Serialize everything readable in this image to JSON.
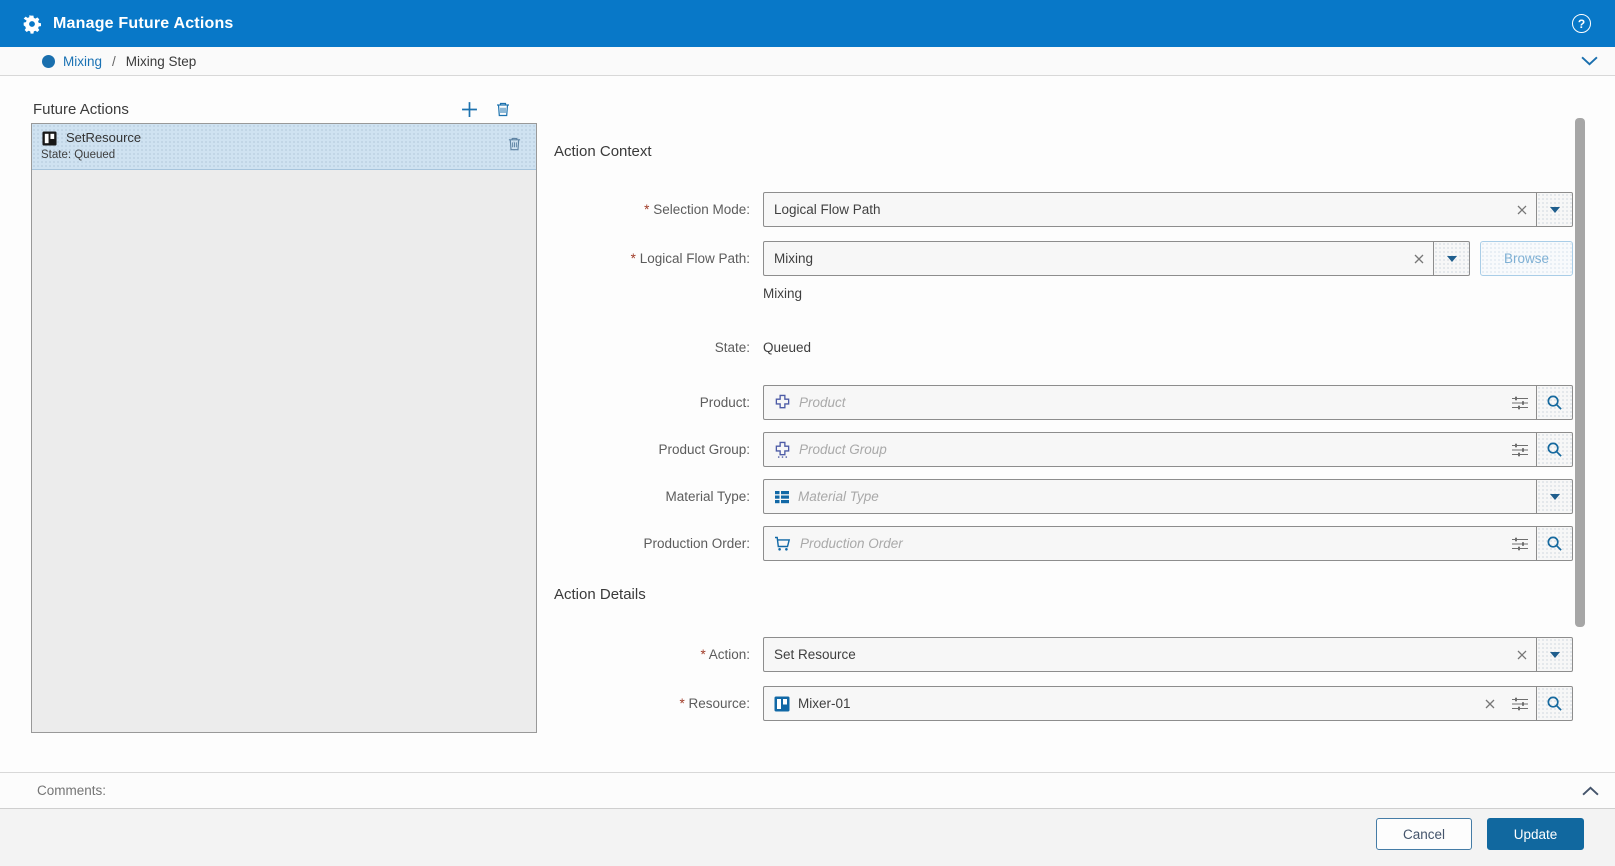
{
  "titlebar": {
    "title": "Manage Future Actions",
    "help_glyph": "?"
  },
  "breadcrumb": {
    "root": "Mixing",
    "separator": "/",
    "current": "Mixing Step"
  },
  "panel": {
    "title": "Future Actions",
    "items": [
      {
        "name": "SetResource",
        "state": "State: Queued"
      }
    ]
  },
  "context": {
    "heading": "Action Context",
    "selection_mode": {
      "label": "Selection Mode:",
      "value": "Logical Flow Path"
    },
    "logical_flow_path": {
      "label": "Logical Flow Path:",
      "value": "Mixing",
      "description": "Mixing",
      "browse_label": "Browse"
    },
    "state": {
      "label": "State:",
      "value": "Queued"
    },
    "product": {
      "label": "Product:",
      "placeholder": "Product"
    },
    "product_group": {
      "label": "Product Group:",
      "placeholder": "Product Group"
    },
    "material_type": {
      "label": "Material Type:",
      "placeholder": "Material Type"
    },
    "production_order": {
      "label": "Production Order:",
      "placeholder": "Production Order"
    }
  },
  "details": {
    "heading": "Action Details",
    "action": {
      "label": "Action:",
      "value": "Set Resource"
    },
    "resource": {
      "label": "Resource:",
      "value": "Mixer-01"
    }
  },
  "comments": {
    "label": "Comments:"
  },
  "footer": {
    "cancel_label": "Cancel",
    "update_label": "Update"
  },
  "colors": {
    "header_bar": "#0878c8",
    "accent_blue": "#1a72b4",
    "icon_blue": "#1168a6",
    "primary_button": "#11689f",
    "selected_item": "#cfe2f1"
  }
}
